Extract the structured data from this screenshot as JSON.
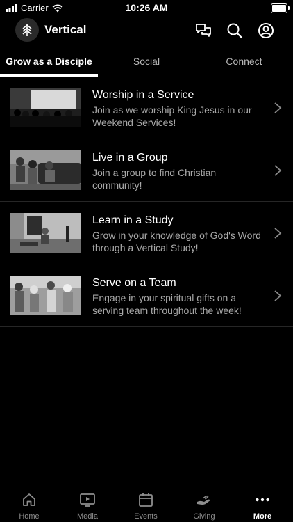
{
  "status_bar": {
    "carrier": "Carrier",
    "time": "10:26 AM"
  },
  "header": {
    "title": "Vertical"
  },
  "tabs": [
    {
      "label": "Grow as a Disciple",
      "active": true
    },
    {
      "label": "Social",
      "active": false
    },
    {
      "label": "Connect",
      "active": false
    }
  ],
  "items": [
    {
      "title": "Worship in a Service",
      "description": "Join as we worship King Jesus in our Weekend Services!"
    },
    {
      "title": "Live in a Group",
      "description": "Join a group to find Christian community!"
    },
    {
      "title": "Learn in a Study",
      "description": "Grow in your knowledge of God's Word through a Vertical Study!"
    },
    {
      "title": "Serve on a Team",
      "description": "Engage in your spiritual gifts on a serving team throughout the week!"
    }
  ],
  "bottom_nav": [
    {
      "label": "Home",
      "icon": "home-icon",
      "active": false
    },
    {
      "label": "Media",
      "icon": "media-icon",
      "active": false
    },
    {
      "label": "Events",
      "icon": "calendar-icon",
      "active": false
    },
    {
      "label": "Giving",
      "icon": "giving-icon",
      "active": false
    },
    {
      "label": "More",
      "icon": "more-icon",
      "active": true
    }
  ],
  "colors": {
    "background": "#000000",
    "text": "#ffffff",
    "muted": "#a8a8a8",
    "divider": "#262626"
  }
}
